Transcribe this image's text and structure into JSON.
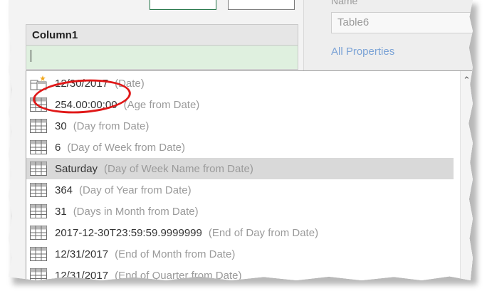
{
  "column_header": "Column1",
  "properties": {
    "name_label": "Name",
    "name_value": "Table6",
    "all_properties_link": "All Properties"
  },
  "suggestions": [
    {
      "value": "12/30/2017",
      "hint": "(Date)",
      "icon": "date-column-icon"
    },
    {
      "value": "254.00:00:00",
      "hint": "(Age from Date)",
      "icon": "table-icon"
    },
    {
      "value": "30",
      "hint": "(Day from Date)",
      "icon": "table-icon"
    },
    {
      "value": "6",
      "hint": "(Day of Week from Date)",
      "icon": "table-icon"
    },
    {
      "value": "Saturday",
      "hint": "(Day of Week Name from Date)",
      "icon": "table-icon",
      "selected": true
    },
    {
      "value": "364",
      "hint": "(Day of Year from Date)",
      "icon": "table-icon"
    },
    {
      "value": "31",
      "hint": "(Days in Month from Date)",
      "icon": "table-icon"
    },
    {
      "value": "2017-12-30T23:59:59.9999999",
      "hint": "(End of Day from Date)",
      "icon": "table-icon"
    },
    {
      "value": "12/31/2017",
      "hint": "(End of Month from Date)",
      "icon": "table-icon"
    },
    {
      "value": "12/31/2017",
      "hint": "(End of Quarter from Date)",
      "icon": "table-icon"
    }
  ],
  "colors": {
    "highlight_circle": "#e01818",
    "formula_bg": "#dff0df",
    "link": "#7ba3d6"
  }
}
